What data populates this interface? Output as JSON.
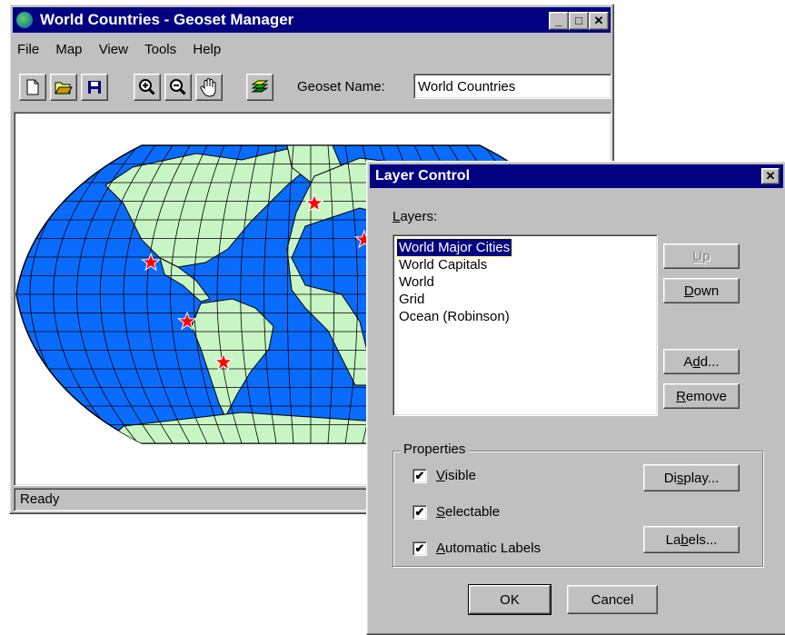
{
  "main_window": {
    "title": "World Countries - Geoset Manager",
    "controls": {
      "minimize": "_",
      "maximize": "□",
      "close": "✕"
    },
    "menu": [
      "File",
      "Map",
      "View",
      "Tools",
      "Help"
    ],
    "toolbar": {
      "icons": [
        "new-icon",
        "open-icon",
        "save-icon",
        "zoom-in-icon",
        "zoom-out-icon",
        "pan-icon",
        "layers-icon"
      ],
      "geoset_label": "Geoset Name:",
      "geoset_value": "World Countries"
    },
    "status": "Ready",
    "map": {
      "ocean_color": "#0a6cff",
      "land_color": "#c8f5c4",
      "city_marker_color": "#ff0000"
    }
  },
  "layer_control": {
    "title": "Layer Control",
    "close": "✕",
    "layers_label": "Layers:",
    "layers": [
      "World Major Cities",
      "World Capitals",
      "World",
      "Grid",
      "Ocean (Robinson)"
    ],
    "selected_layer": "World Major Cities",
    "buttons": {
      "up": "Up",
      "down": "Down",
      "add": "Add...",
      "remove": "Remove",
      "display": "Display...",
      "labels": "Labels...",
      "ok": "OK",
      "cancel": "Cancel"
    },
    "properties_label": "Properties",
    "properties": [
      {
        "label": "Visible",
        "checked": true
      },
      {
        "label": "Selectable",
        "checked": true
      },
      {
        "label": "Automatic Labels",
        "checked": true
      }
    ]
  }
}
